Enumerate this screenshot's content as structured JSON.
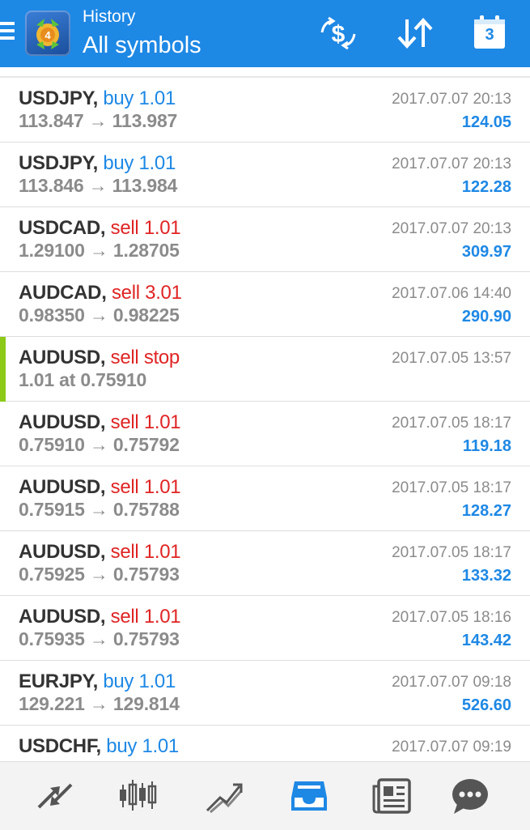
{
  "header": {
    "subtitle": "History",
    "title": "All symbols",
    "calendar_day": "3"
  },
  "rows": [
    {
      "symbol": "USDJPY",
      "side": "buy",
      "volume": "1.01",
      "prices": "113.847 → 113.987",
      "time": "2017.07.07 20:13",
      "profit": "124.05"
    },
    {
      "symbol": "USDJPY",
      "side": "buy",
      "volume": "1.01",
      "prices": "113.846 → 113.984",
      "time": "2017.07.07 20:13",
      "profit": "122.28"
    },
    {
      "symbol": "USDCAD",
      "side": "sell",
      "volume": "1.01",
      "prices": "1.29100 → 1.28705",
      "time": "2017.07.07 20:13",
      "profit": "309.97"
    },
    {
      "symbol": "AUDCAD",
      "side": "sell",
      "volume": "3.01",
      "prices": "0.98350 → 0.98225",
      "time": "2017.07.06 14:40",
      "profit": "290.90"
    },
    {
      "symbol": "AUDUSD",
      "side": "sell",
      "volume": "stop",
      "prices": "1.01 at 0.75910",
      "time": "2017.07.05 13:57",
      "profit": ""
    },
    {
      "symbol": "AUDUSD",
      "side": "sell",
      "volume": "1.01",
      "prices": "0.75910 → 0.75792",
      "time": "2017.07.05 18:17",
      "profit": "119.18"
    },
    {
      "symbol": "AUDUSD",
      "side": "sell",
      "volume": "1.01",
      "prices": "0.75915 → 0.75788",
      "time": "2017.07.05 18:17",
      "profit": "128.27"
    },
    {
      "symbol": "AUDUSD",
      "side": "sell",
      "volume": "1.01",
      "prices": "0.75925 → 0.75793",
      "time": "2017.07.05 18:17",
      "profit": "133.32"
    },
    {
      "symbol": "AUDUSD",
      "side": "sell",
      "volume": "1.01",
      "prices": "0.75935 → 0.75793",
      "time": "2017.07.05 18:16",
      "profit": "143.42"
    },
    {
      "symbol": "EURJPY",
      "side": "buy",
      "volume": "1.01",
      "prices": "129.221 → 129.814",
      "time": "2017.07.07 09:18",
      "profit": "526.60"
    },
    {
      "symbol": "USDCHF",
      "side": "buy",
      "volume": "1.01",
      "prices": "",
      "time": "2017.07.07 09:19",
      "profit": ""
    }
  ],
  "icons": {
    "menu": "hamburger-menu-icon",
    "logo": "metatrader-logo-icon",
    "currency": "currency-exchange-icon",
    "sort": "sort-icon",
    "calendar": "calendar-icon",
    "nav": [
      "quotes-icon",
      "chart-icon",
      "trade-icon",
      "history-icon",
      "news-icon",
      "chat-icon"
    ]
  },
  "colors": {
    "appbar": "#1e88e5",
    "buy": "#1e88e5",
    "sell": "#e02424",
    "profit": "#1e88e5",
    "pending_marker": "#8cc919",
    "nav_active": "#1e88e5",
    "nav_inactive": "#555555"
  }
}
